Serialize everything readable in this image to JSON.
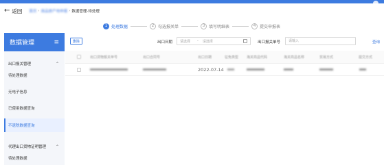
{
  "header": {
    "back_label": "返回",
    "breadcrumbs": [
      "首页",
      "商品原产地申报",
      "数据管理-待处理"
    ]
  },
  "steps": [
    {
      "num": "1",
      "label": "处理数据",
      "active": true
    },
    {
      "num": "2",
      "label": "勾选报关单",
      "active": false
    },
    {
      "num": "3",
      "label": "填写明细表",
      "active": false
    },
    {
      "num": "4",
      "label": "提交申报表",
      "active": false
    }
  ],
  "sidebar": {
    "title": "数据管理",
    "groups": [
      {
        "label": "出口报关管理",
        "items": [
          "待处理数据",
          "无电子信息",
          "已使用数据查询",
          "不退税数据查询"
        ]
      },
      {
        "label": "代理出口货物证明管理",
        "items": [
          "待处理数据"
        ]
      }
    ],
    "active_item": "不退税数据查询"
  },
  "filter": {
    "delete_label": "删除",
    "export_date_label": "出口日期",
    "date_start_placeholder": "请选择",
    "date_end_placeholder": "请选择",
    "declaration_no_label": "出口报关单号",
    "declaration_no_placeholder": "请输入",
    "query_label": "查询"
  },
  "table": {
    "columns": [
      "出口货物报关单号",
      "出口合同号",
      "出口日期",
      "征免类型",
      "海关商品代码",
      "海关商品名称",
      "贸易方式",
      "提交方式"
    ],
    "rows": [
      {
        "export_date": "2022-07-14"
      }
    ]
  }
}
